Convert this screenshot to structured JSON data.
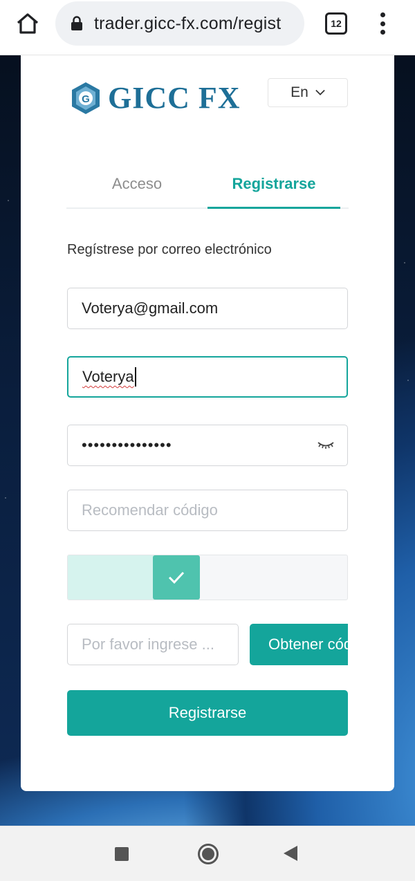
{
  "browser": {
    "url": "trader.gicc-fx.com/regist",
    "tab_count": "12"
  },
  "brand": {
    "name": "GICC FX",
    "mark_letter": "G",
    "color": "#1e6f97"
  },
  "language": {
    "selected": "En"
  },
  "tabs": [
    {
      "label": "Acceso",
      "active": false
    },
    {
      "label": "Registrarse",
      "active": true
    }
  ],
  "form": {
    "caption": "Regístrese por correo electrónico",
    "email_value": "Voterya@gmail.com",
    "username_value": "Voterya",
    "password_value": "•••••••••••••••",
    "referral_placeholder": "Recomendar código",
    "slider_verified": true,
    "code_placeholder": "Por favor ingrese ...",
    "get_code_label": "Obtener código",
    "submit_label": "Registrarse"
  },
  "colors": {
    "accent": "#14a59b",
    "slider_handle": "#4fc3ae",
    "slider_fill": "#d6f3ee"
  },
  "icons": {
    "home": "home-icon",
    "lock": "lock-icon",
    "menu": "more-vert-icon",
    "eye": "eye-closed-icon",
    "check": "check-icon",
    "chevron": "chevron-down-icon"
  }
}
